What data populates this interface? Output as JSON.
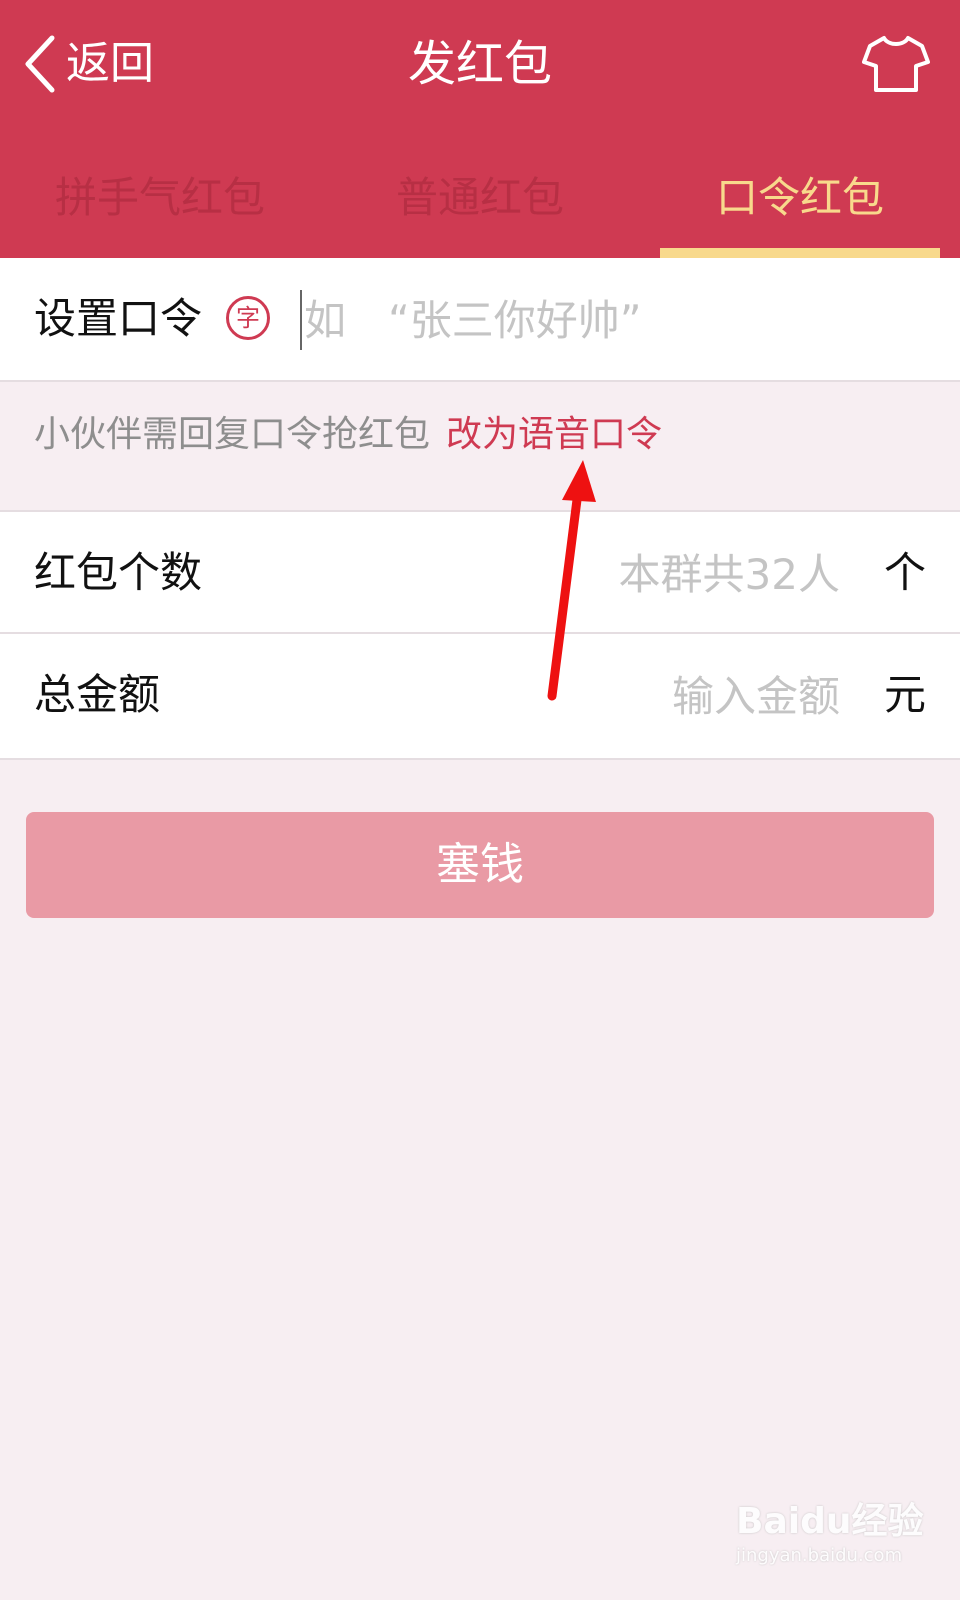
{
  "header": {
    "back_label": "返回",
    "title": "发红包",
    "right_icon": "tshirt-icon",
    "background_color": "#cf3a52"
  },
  "tabs": [
    {
      "label": "拼手气红包",
      "active": false
    },
    {
      "label": "普通红包",
      "active": false
    },
    {
      "label": "口令红包",
      "active": true
    }
  ],
  "password_row": {
    "label": "设置口令",
    "badge": "字",
    "placeholder": "如　“张三你好帅”"
  },
  "hint": {
    "text": "小伙伴需回复口令抢红包",
    "link": "改为语音口令"
  },
  "count_row": {
    "label": "红包个数",
    "placeholder": "本群共32人",
    "unit": "个"
  },
  "amount_row": {
    "label": "总金额",
    "placeholder": "输入金额",
    "unit": "元"
  },
  "submit": {
    "label": "塞钱",
    "color": "#e99aa5"
  },
  "watermark": {
    "brand": "Baidu经验",
    "url": "jingyan.baidu.com"
  }
}
